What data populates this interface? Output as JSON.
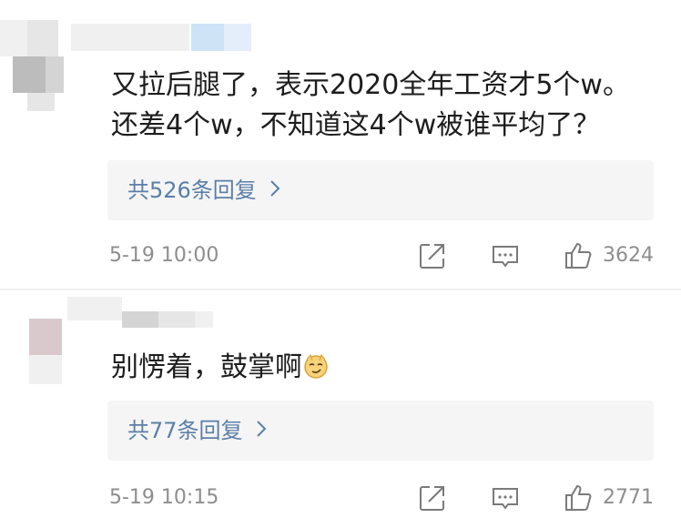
{
  "comments": [
    {
      "text_line1": "又拉后腿了，表示2020全年工资才5个w。",
      "text_line2": "还差4个w，不知道这4个w被谁平均了？",
      "replies_label": "共526条回复",
      "time": "5-19 10:00",
      "likes": "3624",
      "icons": [
        "share-icon",
        "comment-icon",
        "thumbs-up-icon"
      ]
    },
    {
      "text": "别愣着，鼓掌啊",
      "emoji": "smirk-face-emoji",
      "replies_label": "共77条回复",
      "time": "5-19 10:15",
      "likes": "2771",
      "icons": [
        "share-icon",
        "comment-icon",
        "thumbs-up-icon"
      ]
    }
  ],
  "colors": {
    "text": "#1d1d1d",
    "link": "#5b7fa8",
    "meta": "#8e8e8e",
    "reply_bg": "#f5f5f5"
  }
}
